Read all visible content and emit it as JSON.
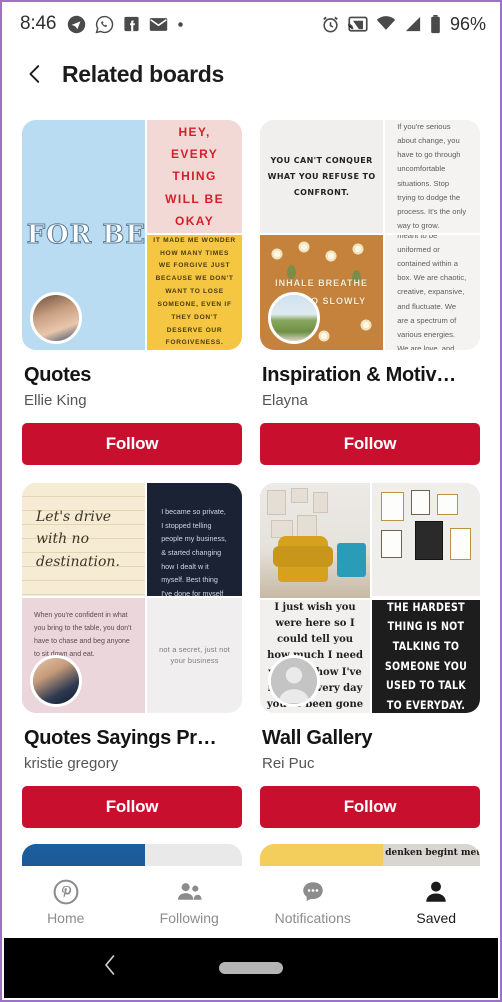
{
  "status_bar": {
    "time": "8:46",
    "battery_percent": "96%",
    "left_icons": [
      "telegram-icon",
      "whatsapp-icon",
      "facebook-icon",
      "mail-icon",
      "dot-icon"
    ],
    "right_icons": [
      "alarm-icon",
      "cast-icon",
      "wifi-icon",
      "signal-icon",
      "battery-icon"
    ]
  },
  "header": {
    "back_icon": "back-chevron-icon",
    "title": "Related boards"
  },
  "theme": {
    "accent_red": "#c8102e",
    "frame_purple": "#9b72c4"
  },
  "boards": [
    {
      "name": "Quotes",
      "owner": "Ellie King",
      "follow_label": "Follow",
      "avatar": "photo-avatar-girls",
      "pins": {
        "big": "NEVER APOLOGIZE FOR BEING WHO YOU ARE.",
        "top": "HEY, EVERY THING WILL BE OKAY",
        "bottom": "IT MADE ME WONDER HOW MANY TIMES WE FORGIVE JUST BECAUSE WE DON'T WANT TO LOSE SOMEONE, EVEN IF THEY DON'T DESERVE OUR FORGIVENESS."
      }
    },
    {
      "name": "Inspiration & Motiv…",
      "owner": "Elayna",
      "follow_label": "Follow",
      "avatar": "photo-avatar-landscape",
      "pins": {
        "big_top": "YOU CAN'T CONQUER WHAT YOU REFUSE TO CONFRONT.",
        "big_bottom": "INHALE BREATHE AND GO SLOWLY",
        "top": "If you're serious about change, you have to go through uncomfortable situations. Stop trying to dodge the process. It's the only way to grow.",
        "bottom": "\"Our souls are not meant to be uniformed or contained within a box. We are chaotic, creative, expansive, and fluctuate. We are a spectrum of various energies. We are love, and love is erratic.\""
      }
    },
    {
      "name": "Quotes Sayings Pr…",
      "owner": "kristie gregory",
      "follow_label": "Follow",
      "avatar": "photo-avatar-woman",
      "pins": {
        "top_left": "Let's drive with no destination.",
        "top_right": "I became so private, I stopped telling people my business, & started changing how I dealt w it myself. Best thing I've done for myself tbh",
        "bottom_left": "When you're confident in what you bring to the table, you don't have to chase and beg anyone to sit down and eat.",
        "bottom_right": "not a secret, just not your business"
      }
    },
    {
      "name": "Wall Gallery",
      "owner": "Rei Puc",
      "follow_label": "Follow",
      "avatar": "default-person-avatar",
      "pins": {
        "top_left": "yellow-armchair-gallery-wall-photo",
        "top_right": "framed-art-gallery-wall-photo",
        "bottom_left": "I just wish you were here so I could tell you how much I need you and how I've missed every day you've been gone",
        "bottom_right": "THE HARDEST THING IS NOT TALKING TO SOMEONE YOU USED TO TALK TO EVERYDAY."
      }
    }
  ],
  "peek_row": {
    "left_pins": [
      "blue-pin",
      "gray-pin"
    ],
    "right_pins": [
      "yellow-confetti-pin",
      "denken begint met taal"
    ]
  },
  "bottom_nav": {
    "items": [
      {
        "label": "Home",
        "icon": "pinterest-icon",
        "active": false
      },
      {
        "label": "Following",
        "icon": "people-icon",
        "active": false
      },
      {
        "label": "Notifications",
        "icon": "chat-bubble-icon",
        "active": false
      },
      {
        "label": "Saved",
        "icon": "person-icon",
        "active": true
      }
    ]
  },
  "android_nav": {
    "back_icon": "system-back-icon",
    "home_pill": "home-indicator-pill"
  }
}
